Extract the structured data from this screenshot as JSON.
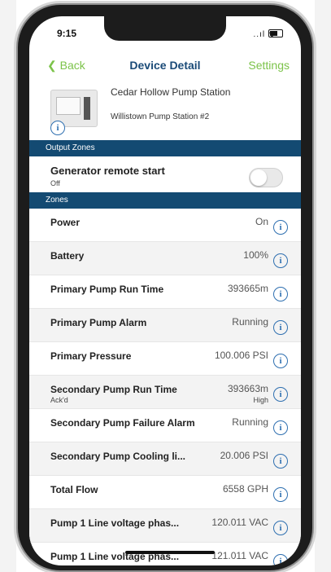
{
  "status_bar": {
    "time": "9:15",
    "signal": "..ıl ᯤ"
  },
  "nav": {
    "back": "Back",
    "title": "Device Detail",
    "settings": "Settings"
  },
  "device": {
    "name": "Cedar Hollow Pump Station",
    "subtitle": "Willistown Pump Station #2"
  },
  "output_zones": {
    "header": "Output Zones",
    "generator": {
      "label": "Generator remote start",
      "state": "Off",
      "toggle_on": false
    }
  },
  "zones": {
    "header": "Zones",
    "rows": [
      {
        "name": "Power",
        "value": "On",
        "sub": "",
        "value_sub": ""
      },
      {
        "name": "Battery",
        "value": "100%",
        "sub": "",
        "value_sub": ""
      },
      {
        "name": "Primary Pump Run Time",
        "value": "393665m",
        "sub": "",
        "value_sub": ""
      },
      {
        "name": "Primary Pump Alarm",
        "value": "Running",
        "sub": "",
        "value_sub": ""
      },
      {
        "name": "Primary Pressure",
        "value": "100.006 PSI",
        "sub": "",
        "value_sub": ""
      },
      {
        "name": "Secondary Pump Run Time",
        "value": "393663m",
        "sub": "Ack'd",
        "value_sub": "High"
      },
      {
        "name": "Secondary Pump Failure Alarm",
        "value": "Running",
        "sub": "",
        "value_sub": ""
      },
      {
        "name": "Secondary Pump Cooling li...",
        "value": "20.006 PSI",
        "sub": "",
        "value_sub": ""
      },
      {
        "name": "Total Flow",
        "value": "6558 GPH",
        "sub": "",
        "value_sub": ""
      },
      {
        "name": "Pump 1 Line voltage phas...",
        "value": "120.011 VAC",
        "sub": "",
        "value_sub": ""
      },
      {
        "name": "Pump 1 Line voltage phas...",
        "value": "121.011 VAC",
        "sub": "",
        "value_sub": ""
      }
    ]
  },
  "colors": {
    "accent_green": "#7cc34a",
    "title_navy": "#1a4a77",
    "section_bg": "#134a72",
    "info_blue": "#2e6fb0"
  }
}
